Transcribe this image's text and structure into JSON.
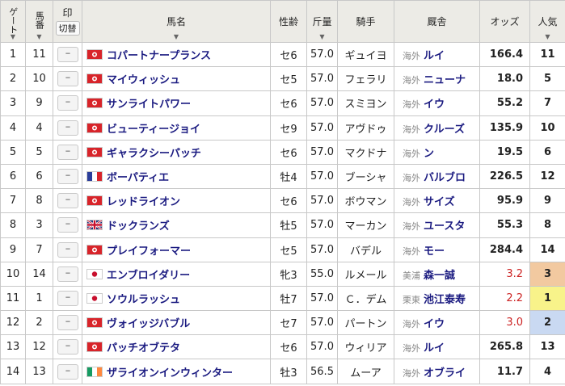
{
  "header": {
    "gate": "ゲート",
    "num": "馬番",
    "mark": "印",
    "toggle": "切替",
    "name": "馬名",
    "sex": "性齢",
    "weight": "斤量",
    "jockey": "騎手",
    "trainer": "厩舎",
    "odds": "オッズ",
    "pop": "人気",
    "sort_glyph": "▼"
  },
  "mark_placeholder": "--",
  "rows": [
    {
      "gate": "1",
      "num": "11",
      "flag": "hk",
      "name": "コパートナープランス",
      "sex": "セ6",
      "weight": "57.0",
      "jockey": "ギュイヨ",
      "region": "海外",
      "trainer": "ルイ",
      "odds": "166.4",
      "pop": "11",
      "pop_bg": "",
      "low": false
    },
    {
      "gate": "2",
      "num": "10",
      "flag": "hk",
      "name": "マイウィッシュ",
      "sex": "セ5",
      "weight": "57.0",
      "jockey": "フェラリ",
      "region": "海外",
      "trainer": "ニューナ",
      "odds": "18.0",
      "pop": "5",
      "pop_bg": "",
      "low": false
    },
    {
      "gate": "3",
      "num": "9",
      "flag": "hk",
      "name": "サンライトパワー",
      "sex": "セ6",
      "weight": "57.0",
      "jockey": "スミヨン",
      "region": "海外",
      "trainer": "イウ",
      "odds": "55.2",
      "pop": "7",
      "pop_bg": "",
      "low": false
    },
    {
      "gate": "4",
      "num": "4",
      "flag": "hk",
      "name": "ビューティージョイ",
      "sex": "セ9",
      "weight": "57.0",
      "jockey": "アヴドゥ",
      "region": "海外",
      "trainer": "クルーズ",
      "odds": "135.9",
      "pop": "10",
      "pop_bg": "",
      "low": false
    },
    {
      "gate": "5",
      "num": "5",
      "flag": "hk",
      "name": "ギャラクシーパッチ",
      "sex": "セ6",
      "weight": "57.0",
      "jockey": "マクドナ",
      "region": "海外",
      "trainer": "ン",
      "odds": "19.5",
      "pop": "6",
      "pop_bg": "",
      "low": false
    },
    {
      "gate": "6",
      "num": "6",
      "flag": "fr",
      "name": "ボーパティエ",
      "sex": "牡4",
      "weight": "57.0",
      "jockey": "ブーシャ",
      "region": "海外",
      "trainer": "バルブロ",
      "odds": "226.5",
      "pop": "12",
      "pop_bg": "",
      "low": false
    },
    {
      "gate": "7",
      "num": "8",
      "flag": "hk",
      "name": "レッドライオン",
      "sex": "セ6",
      "weight": "57.0",
      "jockey": "ボウマン",
      "region": "海外",
      "trainer": "サイズ",
      "odds": "95.9",
      "pop": "9",
      "pop_bg": "",
      "low": false
    },
    {
      "gate": "8",
      "num": "3",
      "flag": "gb",
      "name": "ドックランズ",
      "sex": "牡5",
      "weight": "57.0",
      "jockey": "マーカン",
      "region": "海外",
      "trainer": "ユースタ",
      "odds": "55.3",
      "pop": "8",
      "pop_bg": "",
      "low": false
    },
    {
      "gate": "9",
      "num": "7",
      "flag": "hk",
      "name": "プレイフォーマー",
      "sex": "セ5",
      "weight": "57.0",
      "jockey": "バデル",
      "region": "海外",
      "trainer": "モー",
      "odds": "284.4",
      "pop": "14",
      "pop_bg": "",
      "low": false
    },
    {
      "gate": "10",
      "num": "14",
      "flag": "jp",
      "name": "エンブロイダリー",
      "sex": "牝3",
      "weight": "55.0",
      "jockey": "ルメール",
      "region": "美浦",
      "trainer": "森一誠",
      "odds": "3.2",
      "pop": "3",
      "pop_bg": "#f2c9a0",
      "low": true
    },
    {
      "gate": "11",
      "num": "1",
      "flag": "jp",
      "name": "ソウルラッシュ",
      "sex": "牡7",
      "weight": "57.0",
      "jockey": "Ｃ．デム",
      "region": "栗東",
      "trainer": "池江泰寿",
      "odds": "2.2",
      "pop": "1",
      "pop_bg": "#f8f38a",
      "low": true
    },
    {
      "gate": "12",
      "num": "2",
      "flag": "hk",
      "name": "ヴォイッジバブル",
      "sex": "セ7",
      "weight": "57.0",
      "jockey": "パートン",
      "region": "海外",
      "trainer": "イウ",
      "odds": "3.0",
      "pop": "2",
      "pop_bg": "#c9d9f2",
      "low": true
    },
    {
      "gate": "13",
      "num": "12",
      "flag": "hk",
      "name": "パッチオブテタ",
      "sex": "セ6",
      "weight": "57.0",
      "jockey": "ウィリア",
      "region": "海外",
      "trainer": "ルイ",
      "odds": "265.8",
      "pop": "13",
      "pop_bg": "",
      "low": false
    },
    {
      "gate": "14",
      "num": "13",
      "flag": "ie",
      "name": "ザライオンインウィンター",
      "sex": "牡3",
      "weight": "56.5",
      "jockey": "ムーア",
      "region": "海外",
      "trainer": "オブライ",
      "odds": "11.7",
      "pop": "4",
      "pop_bg": "",
      "low": false
    }
  ]
}
